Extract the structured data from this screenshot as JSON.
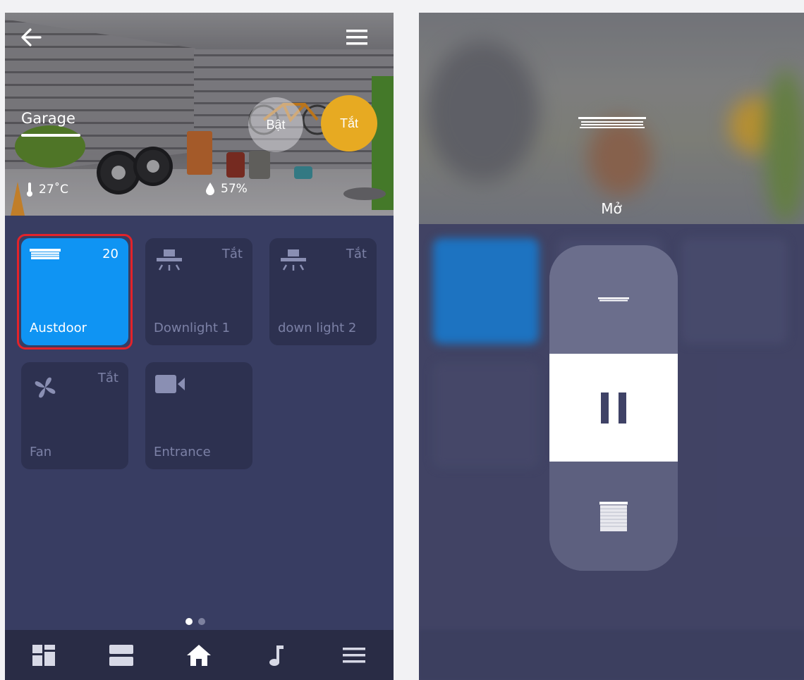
{
  "left_screen": {
    "room": {
      "name": "Garage",
      "temperature": "27˚C",
      "humidity": "57%"
    },
    "header": {
      "back_icon": "arrow-left-icon",
      "menu_icon": "hamburger-menu-icon"
    },
    "scene_buttons": {
      "on_label": "Bật",
      "off_label": "Tắt"
    },
    "devices": [
      {
        "name": "Austdoor",
        "state": "20",
        "icon": "window-blind-icon",
        "active": true
      },
      {
        "name": "Downlight 1",
        "state": "Tắt",
        "icon": "ceiling-light-icon",
        "active": false
      },
      {
        "name": "down light 2",
        "state": "Tắt",
        "icon": "ceiling-light-icon",
        "active": false
      },
      {
        "name": "Fan",
        "state": "Tắt",
        "icon": "fan-icon",
        "active": false
      },
      {
        "name": "Entrance",
        "state": "",
        "icon": "video-camera-icon",
        "active": false
      }
    ],
    "page_indicator": {
      "current": 1,
      "total": 2
    },
    "bottom_nav": [
      {
        "icon": "dashboard-grid-icon"
      },
      {
        "icon": "rooms-list-icon"
      },
      {
        "icon": "home-icon",
        "active": true
      },
      {
        "icon": "music-note-icon"
      },
      {
        "icon": "hamburger-menu-icon"
      }
    ],
    "colors": {
      "background": "#383d62",
      "tile": "#2d3150",
      "tile_active": "#0f94f3",
      "off_button": "#e7aa22",
      "highlight": "#e3232a"
    }
  },
  "right_screen": {
    "status_label": "Mở",
    "controls": [
      {
        "action": "open",
        "icon": "blind-open-icon"
      },
      {
        "action": "pause",
        "icon": "pause-icon"
      },
      {
        "action": "close",
        "icon": "blind-closed-icon"
      }
    ]
  }
}
